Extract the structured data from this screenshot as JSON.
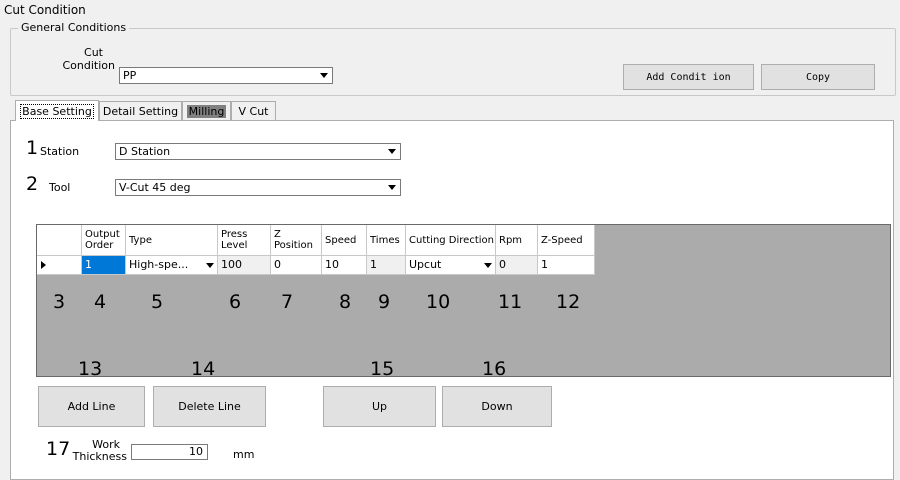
{
  "window": {
    "title": "Cut Condition"
  },
  "general": {
    "legend": "General Conditions",
    "cut_label_1": "Cut",
    "cut_label_2": "Condition",
    "cut_value": "PP",
    "add_condition": "Add Condit ion",
    "copy": "Copy"
  },
  "tabs": [
    {
      "label": "Base Setting"
    },
    {
      "label": "Detail Setting"
    },
    {
      "label": "Milling"
    },
    {
      "label": "V Cut"
    }
  ],
  "station": {
    "num": "1",
    "label": "Station",
    "value": "D Station"
  },
  "tool": {
    "num": "2",
    "label": "Tool",
    "value": "V-Cut 45 deg"
  },
  "grid": {
    "headers": {
      "order": "Output Order",
      "type": "Type",
      "press": "Press Level",
      "zpos": "Z Position",
      "speed": "Speed",
      "times": "Times",
      "cutdir": "Cutting Direction",
      "rpm": "Rpm",
      "zspeed": "Z-Speed"
    },
    "row": {
      "order": "1",
      "type": "High-spe...",
      "press": "100",
      "zpos": "0",
      "speed": "10",
      "times": "1",
      "cutdir": "Upcut",
      "rpm": "0",
      "zspeed": "1"
    }
  },
  "callouts": [
    "3",
    "4",
    "5",
    "6",
    "7",
    "8",
    "9",
    "10",
    "11",
    "12",
    "13",
    "14",
    "15",
    "16",
    "17"
  ],
  "buttons": {
    "add": "Add Line",
    "delete": "Delete Line",
    "up": "Up",
    "down": "Down"
  },
  "work": {
    "label_1": "Work",
    "label_2": "Thickness",
    "value": "10",
    "unit": "mm"
  }
}
